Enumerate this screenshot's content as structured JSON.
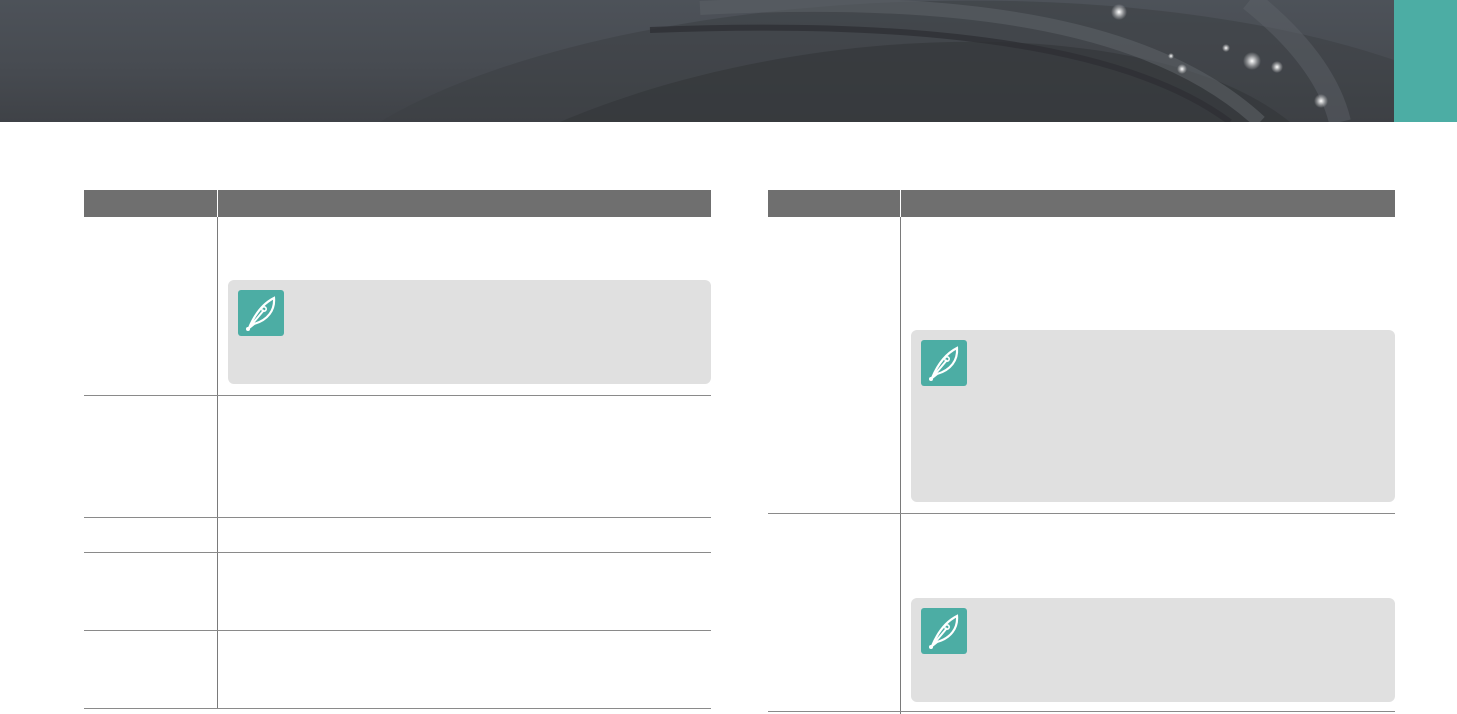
{
  "colors": {
    "accent": "#4cada4",
    "table_header": "#6f6f6f",
    "note_background": "#e0e0e0",
    "banner": "#474b51"
  },
  "icons": {
    "note": "note-pen-icon"
  },
  "left_table": {
    "header": {
      "option": "",
      "description": ""
    },
    "rows": [
      {
        "option": "",
        "description": "",
        "note": ""
      },
      {
        "option": "",
        "description": ""
      },
      {
        "option": "",
        "description": ""
      },
      {
        "option": "",
        "description": ""
      },
      {
        "option": "",
        "description": ""
      }
    ]
  },
  "right_table": {
    "header": {
      "option": "",
      "description": ""
    },
    "rows": [
      {
        "option": "",
        "description": "",
        "note": ""
      },
      {
        "option": "",
        "description": "",
        "note": ""
      }
    ]
  }
}
